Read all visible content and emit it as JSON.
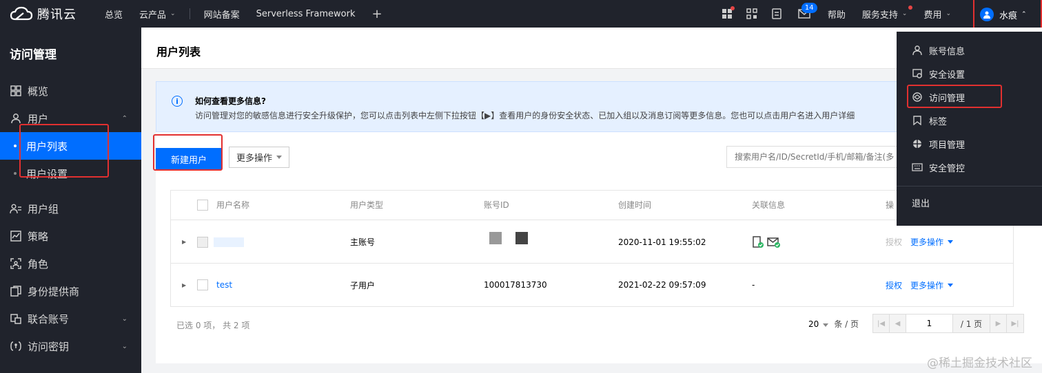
{
  "topbar": {
    "logo": "腾讯云",
    "nav": [
      "总览",
      "云产品",
      "网站备案",
      "Serverless Framework"
    ],
    "help": "帮助",
    "service": "服务支持",
    "billing": "费用",
    "mail_count": "14",
    "user": "水痕"
  },
  "sidebar": {
    "title": "访问管理",
    "items": {
      "overview": "概览",
      "users": "用户",
      "user_list": "用户列表",
      "user_settings": "用户设置",
      "groups": "用户组",
      "policies": "策略",
      "roles": "角色",
      "idp": "身份提供商",
      "federated": "联合账号",
      "keys": "访问密钥"
    }
  },
  "page": {
    "title": "用户列表",
    "notice_title": "如何查看更多信息?",
    "notice_desc": "访问管理对您的敏感信息进行安全升级保护，您可以点击列表中左侧下拉按钮【▶】查看用户的身份安全状态、已加入组以及消息订阅等更多信息。您也可以点击用户名进入用户详细",
    "new_user": "新建用户",
    "more_actions": "更多操作",
    "search_placeholder": "搜索用户名/ID/SecretId/手机/邮箱/备注(多"
  },
  "table": {
    "headers": [
      "用户名称",
      "用户类型",
      "账号ID",
      "创建时间",
      "关联信息",
      "操"
    ],
    "rows": [
      {
        "name": "",
        "type": "主账号",
        "id": "",
        "created": "2020-11-01 19:55:02",
        "link": "",
        "auth": "授权",
        "more": "更多操作"
      },
      {
        "name": "test",
        "type": "子用户",
        "id": "100017813730",
        "created": "2021-02-22 09:57:09",
        "link": "-",
        "auth": "授权",
        "more": "更多操作"
      }
    ]
  },
  "footer": {
    "selected": "已选 0 项，  共 2 项",
    "page_size": "20",
    "per_page": "条 / 页",
    "page": "1",
    "total_pages": "/ 1 页"
  },
  "dropdown": {
    "items": [
      "账号信息",
      "安全设置",
      "访问管理",
      "标签",
      "项目管理",
      "安全管控"
    ],
    "logout": "退出"
  },
  "watermark": "@稀土掘金技术社区",
  "colors": {
    "brand": "#006eff",
    "dark": "#20232c",
    "highlight": "#e23030"
  }
}
